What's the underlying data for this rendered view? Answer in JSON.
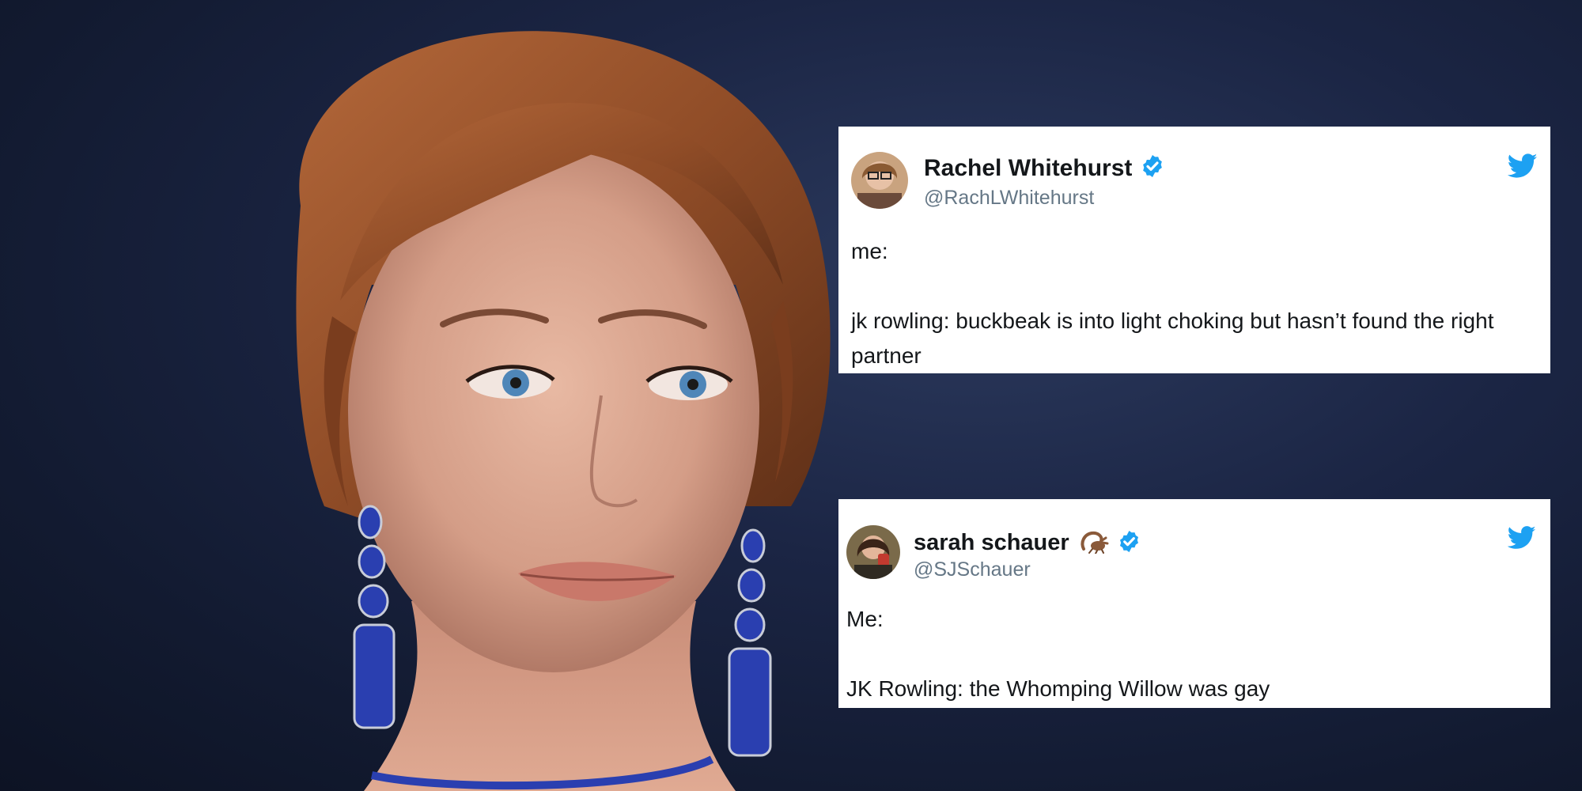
{
  "tweets": [
    {
      "display_name": "Rachel Whitehurst",
      "handle": "@RachLWhitehurst",
      "text": "me:\n\njk rowling: buckbeak is into light choking but hasn’t found the right partner",
      "verified": true,
      "avatar_icon": "avatar-photo",
      "platform_icon": "twitter-bird-icon"
    },
    {
      "display_name": "sarah schauer",
      "handle": "@SJSchauer",
      "text": "Me:\n\nJK Rowling: the Whomping Willow was gay",
      "verified": true,
      "name_emoji": "scorpion-emoji",
      "avatar_icon": "avatar-photo",
      "platform_icon": "twitter-bird-icon"
    }
  ],
  "colors": {
    "twitter_blue": "#1da1f2",
    "verified_blue": "#1da1f2",
    "name_text": "#14171a",
    "handle_text": "#657786",
    "card_background": "#ffffff",
    "background": "#1b2544"
  }
}
